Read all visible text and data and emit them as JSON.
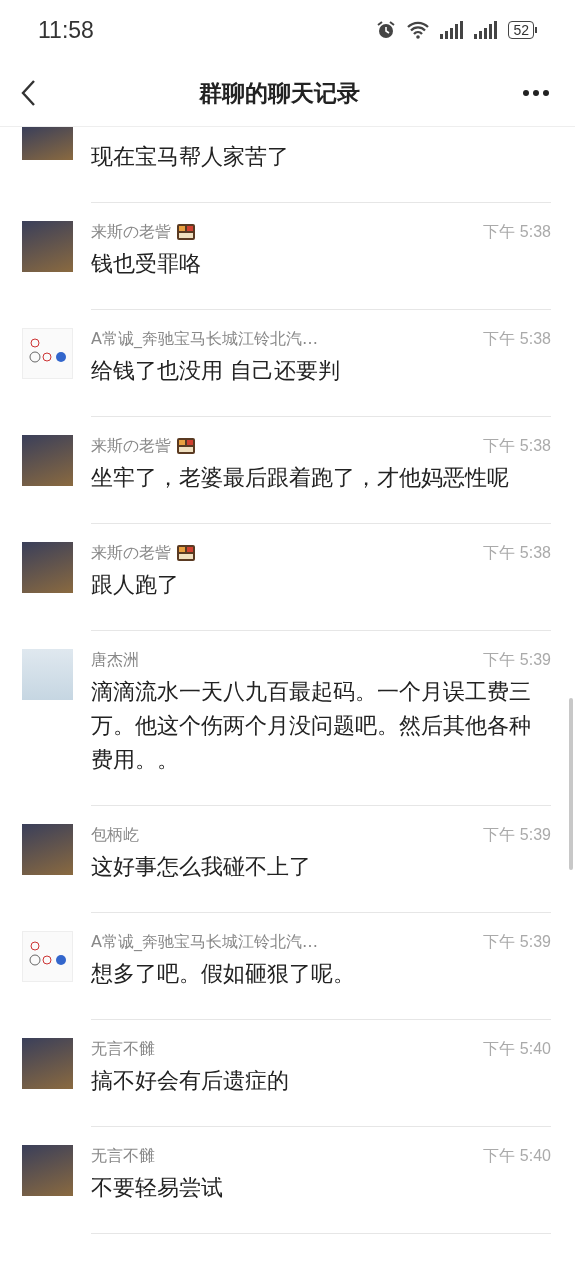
{
  "status_bar": {
    "time": "11:58",
    "battery": "52"
  },
  "header": {
    "title": "群聊的聊天记录"
  },
  "messages": [
    {
      "cut_off": true,
      "kind": "photo",
      "text": "现在宝马帮人家苦了"
    },
    {
      "cut_off": false,
      "kind": "photo",
      "name": "来斯の老訾",
      "badge": true,
      "time": "下午 5:38",
      "text": "钱也受罪咯"
    },
    {
      "cut_off": false,
      "kind": "logos",
      "name": "A常诚_奔驰宝马长城江铃北汽…",
      "badge": false,
      "time": "下午 5:38",
      "text": "给钱了也没用 自己还要判"
    },
    {
      "cut_off": false,
      "kind": "photo",
      "name": "来斯の老訾",
      "badge": true,
      "time": "下午 5:38",
      "text": "坐牢了，老婆最后跟着跑了，才他妈恶性呢"
    },
    {
      "cut_off": false,
      "kind": "photo",
      "name": "来斯の老訾",
      "badge": true,
      "time": "下午 5:38",
      "text": "跟人跑了"
    },
    {
      "cut_off": false,
      "kind": "landscape",
      "name": "唐杰洲",
      "badge": false,
      "time": "下午 5:39",
      "text": "滴滴流水一天八九百最起码。一个月误工费三万。他这个伤两个月没问题吧。然后其他各种费用。。"
    },
    {
      "cut_off": false,
      "kind": "photo",
      "name": "包柄屹",
      "badge": false,
      "time": "下午 5:39",
      "text": "这好事怎么我碰不上了"
    },
    {
      "cut_off": false,
      "kind": "logos",
      "name": "A常诚_奔驰宝马长城江铃北汽…",
      "badge": false,
      "time": "下午 5:39",
      "text": "想多了吧。假如砸狠了呢。"
    },
    {
      "cut_off": false,
      "kind": "photo",
      "name": "无言不雠",
      "badge": false,
      "time": "下午 5:40",
      "text": "搞不好会有后遗症的"
    },
    {
      "cut_off": false,
      "kind": "photo",
      "name": "无言不雠",
      "badge": false,
      "time": "下午 5:40",
      "text": "不要轻易尝试"
    }
  ]
}
